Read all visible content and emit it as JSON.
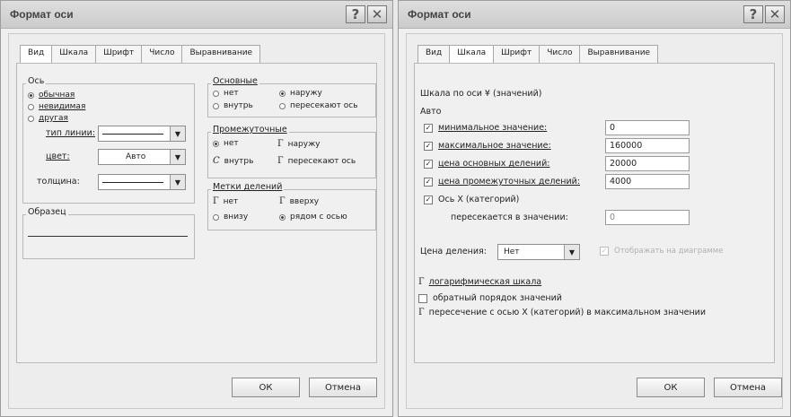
{
  "left": {
    "title": "Формат оси",
    "tabs": [
      "Вид",
      "Шкала",
      "Шрифт",
      "Число",
      "Выравнивание"
    ],
    "axis_group": {
      "title": "Ось",
      "options": [
        "обычная",
        "невидимая",
        "другая"
      ],
      "line_type_label": "тип линии:",
      "color_label": "цвет:",
      "color_value": "Авто",
      "weight_label": "толщина:"
    },
    "sample_title": "Образец",
    "major_group": {
      "title": "Основные",
      "opt_none": "нет",
      "opt_out": "наружу",
      "opt_in": "внутрь",
      "opt_cross": "пересекают ось"
    },
    "minor_group": {
      "title": "Промежуточные",
      "opt_none": "нет",
      "opt_out": "наружу",
      "opt_in": "внутрь",
      "opt_cross": "пересекают ось",
      "glyph_c": "С",
      "glyph_g1": "Г",
      "glyph_g2": "Г"
    },
    "labels_group": {
      "title": "Метки делений",
      "opt_none": "нет",
      "opt_up": "вверху",
      "opt_down": "внизу",
      "opt_next": "рядом с осью",
      "glyph_g1": "Г",
      "glyph_g2": "Г"
    },
    "ok": "ОК",
    "cancel": "Отмена"
  },
  "right": {
    "title": "Формат оси",
    "tabs": [
      "Вид",
      "Шкала",
      "Шрифт",
      "Число",
      "Выравнивание"
    ],
    "scale_header": "Шкала по оси ¥ (значений)",
    "auto_label": "Авто",
    "rows": [
      {
        "label": "минимальное значение:",
        "value": "0"
      },
      {
        "label": "максимальное значение:",
        "value": "160000"
      },
      {
        "label": "цена основных делений:",
        "value": "20000"
      },
      {
        "label": "цена промежуточных делений:",
        "value": "4000"
      }
    ],
    "cross_label": "Ось Х (категорий)",
    "cross_sub": "пересекается в значении:",
    "cross_value": "0",
    "units_label": "Цена деления:",
    "units_value": "Нет",
    "units_check": "Отображать на диаграмме",
    "log_label": "логарифмическая шкала",
    "reverse_label": "обратный порядок значений",
    "max_cross_label": "пересечение с осью Х (категорий) в максимальном значении",
    "glyph_g": "Г",
    "ok": "ОК",
    "cancel": "Отмена"
  }
}
